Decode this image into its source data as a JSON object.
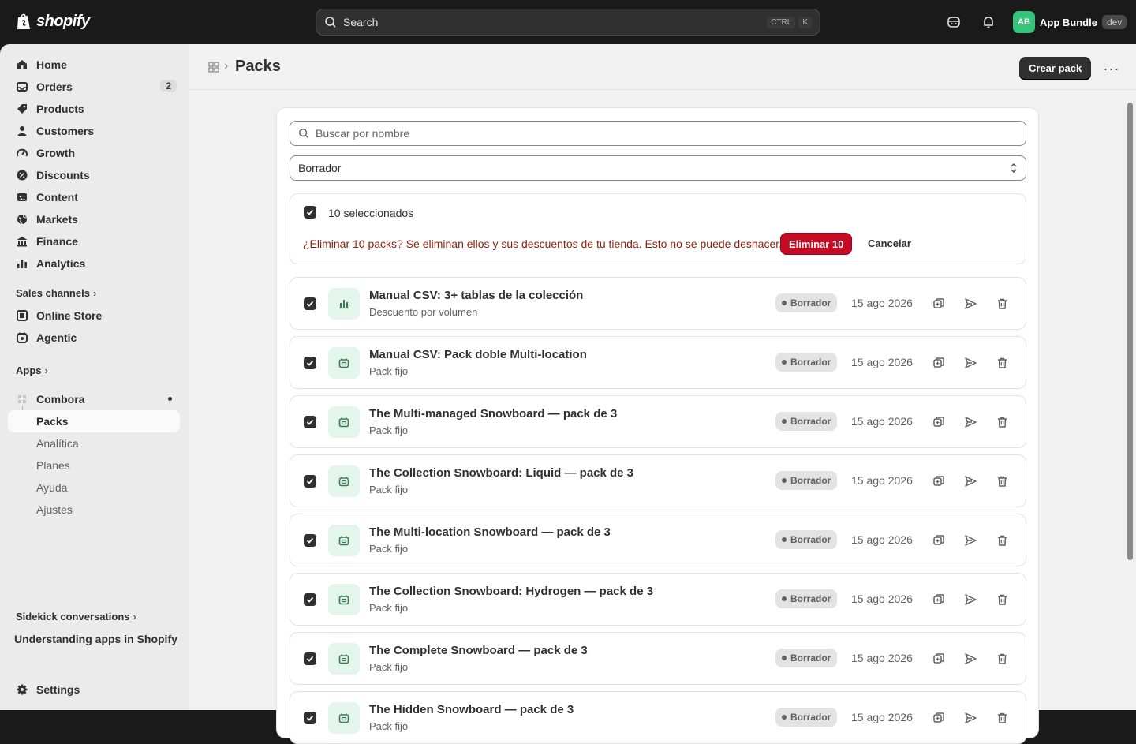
{
  "topbar": {
    "brand": "shopify",
    "search_label": "Search",
    "shortcut_ctrl": "CTRL",
    "shortcut_k": "K",
    "store_initials": "AB",
    "store_name": "App Bundle",
    "env_badge": "dev"
  },
  "sidebar": {
    "items": [
      {
        "label": "Home",
        "icon": "home-icon"
      },
      {
        "label": "Orders",
        "icon": "inbox-icon",
        "count": "2"
      },
      {
        "label": "Products",
        "icon": "tag-icon"
      },
      {
        "label": "Customers",
        "icon": "person-icon"
      },
      {
        "label": "Growth",
        "icon": "gauge-icon"
      },
      {
        "label": "Discounts",
        "icon": "discount-icon"
      },
      {
        "label": "Content",
        "icon": "content-icon"
      },
      {
        "label": "Markets",
        "icon": "globe-icon"
      },
      {
        "label": "Finance",
        "icon": "bank-icon"
      },
      {
        "label": "Analytics",
        "icon": "bar-chart-icon"
      }
    ],
    "sales_channels_label": "Sales channels",
    "channels": [
      {
        "label": "Online Store",
        "icon": "store-icon"
      },
      {
        "label": "Agentic",
        "icon": "agentic-icon"
      }
    ],
    "apps_label": "Apps",
    "app_name": "Combora",
    "app_pages": [
      "Packs",
      "Analítica",
      "Planes",
      "Ayuda",
      "Ajustes"
    ],
    "sidekick_label": "Sidekick conversations",
    "sidekick_item": "Understanding apps in Shopify",
    "settings_label": "Settings"
  },
  "header": {
    "title": "Packs",
    "primary_action": "Crear pack",
    "more": "···"
  },
  "filters": {
    "search_placeholder": "Buscar por nombre",
    "status_selected": "Borrador"
  },
  "bulk": {
    "selected_text": "10 seleccionados",
    "warning": "¿Eliminar 10 packs? Se eliminan ellos y sus descuentos de tu tienda. Esto no se puede deshacer.",
    "delete_label": "Eliminar 10",
    "cancel_label": "Cancelar"
  },
  "packs": [
    {
      "title": "Manual CSV: 3+ tablas de la colección",
      "type": "Descuento por volumen",
      "status": "Borrador",
      "date": "15 ago 2026",
      "icon": "volume-chart-icon"
    },
    {
      "title": "Manual CSV: Pack doble Multi-location",
      "type": "Pack fijo",
      "status": "Borrador",
      "date": "15 ago 2026",
      "icon": "bundle-icon"
    },
    {
      "title": "The Multi-managed Snowboard — pack de 3",
      "type": "Pack fijo",
      "status": "Borrador",
      "date": "15 ago 2026",
      "icon": "bundle-icon"
    },
    {
      "title": "The Collection Snowboard: Liquid — pack de 3",
      "type": "Pack fijo",
      "status": "Borrador",
      "date": "15 ago 2026",
      "icon": "bundle-icon"
    },
    {
      "title": "The Multi-location Snowboard — pack de 3",
      "type": "Pack fijo",
      "status": "Borrador",
      "date": "15 ago 2026",
      "icon": "bundle-icon"
    },
    {
      "title": "The Collection Snowboard: Hydrogen — pack de 3",
      "type": "Pack fijo",
      "status": "Borrador",
      "date": "15 ago 2026",
      "icon": "bundle-icon"
    },
    {
      "title": "The Complete Snowboard — pack de 3",
      "type": "Pack fijo",
      "status": "Borrador",
      "date": "15 ago 2026",
      "icon": "bundle-icon"
    },
    {
      "title": "The Hidden Snowboard — pack de 3",
      "type": "Pack fijo",
      "status": "Borrador",
      "date": "15 ago 2026",
      "icon": "bundle-icon"
    }
  ],
  "colors": {
    "topbar": "#1a1a1a",
    "danger": "#c70a24",
    "warning_text": "#8e1f0b",
    "avatar": "#36c47a",
    "thumb_bg": "#e4f6ec"
  }
}
